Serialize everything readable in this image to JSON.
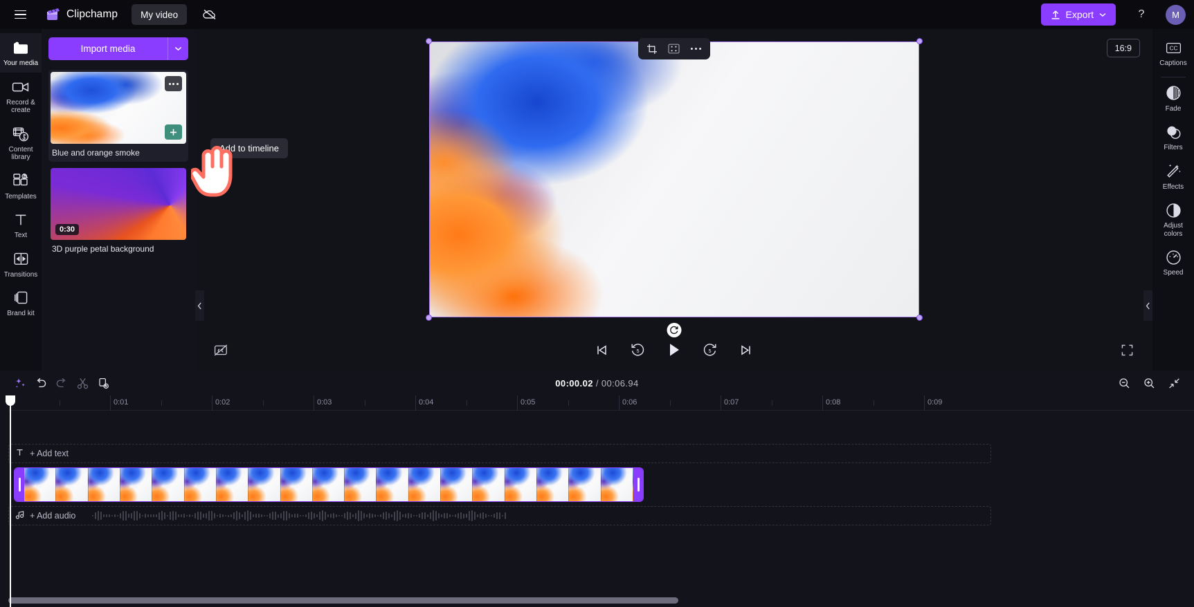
{
  "app": {
    "brand": "Clipchamp",
    "project_name": "My video",
    "menu_icon": "hamburger-icon",
    "cloud_icon": "cloud-off-icon",
    "export_label": "Export",
    "help_label": "?",
    "avatar_initial": "M",
    "accent": "#8b3dff",
    "add_accent": "#3f8f7d",
    "cursor_color": "#ff6f61"
  },
  "left_rail": [
    {
      "label": "Your media",
      "icon": "folder-icon",
      "active": true
    },
    {
      "label": "Record & create",
      "icon": "video-camera-icon",
      "active": false
    },
    {
      "label": "Content library",
      "icon": "content-library-icon",
      "active": false
    },
    {
      "label": "Templates",
      "icon": "templates-icon",
      "active": false
    },
    {
      "label": "Text",
      "icon": "text-icon",
      "active": false
    },
    {
      "label": "Transitions",
      "icon": "transitions-icon",
      "active": false
    },
    {
      "label": "Brand kit",
      "icon": "brand-kit-icon",
      "active": false
    }
  ],
  "right_rail": [
    {
      "label": "Captions",
      "icon": "closed-captions-icon"
    },
    {
      "label": "Fade",
      "icon": "fade-icon"
    },
    {
      "label": "Filters",
      "icon": "filters-icon"
    },
    {
      "label": "Effects",
      "icon": "effects-icon"
    },
    {
      "label": "Adjust colors",
      "icon": "adjust-colors-icon"
    },
    {
      "label": "Speed",
      "icon": "speed-icon"
    }
  ],
  "media_panel": {
    "import_label": "Import media",
    "import_caret_icon": "chevron-down-icon",
    "items": [
      {
        "name": "Blue and orange smoke",
        "duration": "",
        "selected": true,
        "more_icon": "more-options-icon",
        "add_icon": "plus-icon"
      },
      {
        "name": "3D purple petal background",
        "duration": "0:30",
        "selected": false,
        "more_icon": "more-options-icon",
        "add_icon": "plus-icon"
      }
    ]
  },
  "tooltip": {
    "text": "Add to timeline"
  },
  "stage": {
    "aspect_ratio": "16:9",
    "float_tools": [
      {
        "icon": "crop-icon"
      },
      {
        "icon": "fit-to-frame-icon"
      },
      {
        "icon": "more-options-icon"
      }
    ],
    "rotate_icon": "rotate-icon",
    "controls": {
      "captions_off_icon": "captions-off-icon",
      "skip_back_icon": "skip-to-start-icon",
      "rewind_label": "5",
      "play_icon": "play-icon",
      "forward_label": "5",
      "skip_forward_icon": "skip-to-end-icon",
      "fullscreen_icon": "fullscreen-icon"
    }
  },
  "timeline": {
    "tools": [
      {
        "icon": "magic-wand-icon",
        "name": "auto-compose-button"
      },
      {
        "icon": "undo-icon",
        "name": "undo-button"
      },
      {
        "icon": "redo-icon",
        "name": "redo-button"
      },
      {
        "icon": "split-icon",
        "name": "split-button"
      },
      {
        "icon": "duplicate-icon",
        "name": "duplicate-button"
      }
    ],
    "current_time": "00:00.02",
    "total_time": "00:06.94",
    "time_separator": "/",
    "zoom_out_icon": "zoom-out-icon",
    "zoom_in_icon": "zoom-in-icon",
    "fit_icon": "fit-timeline-icon",
    "ruler_labels": [
      "0:01",
      "0:02",
      "0:03",
      "0:04",
      "0:05",
      "0:06",
      "0:07",
      "0:08",
      "0:09"
    ],
    "add_text_label": "+ Add text",
    "add_text_icon": "text-icon",
    "add_audio_label": "+ Add audio",
    "add_audio_icon": "music-note-icon",
    "clip": {
      "name": "Blue and orange smoke",
      "frame_count": 19,
      "selected": true
    }
  }
}
